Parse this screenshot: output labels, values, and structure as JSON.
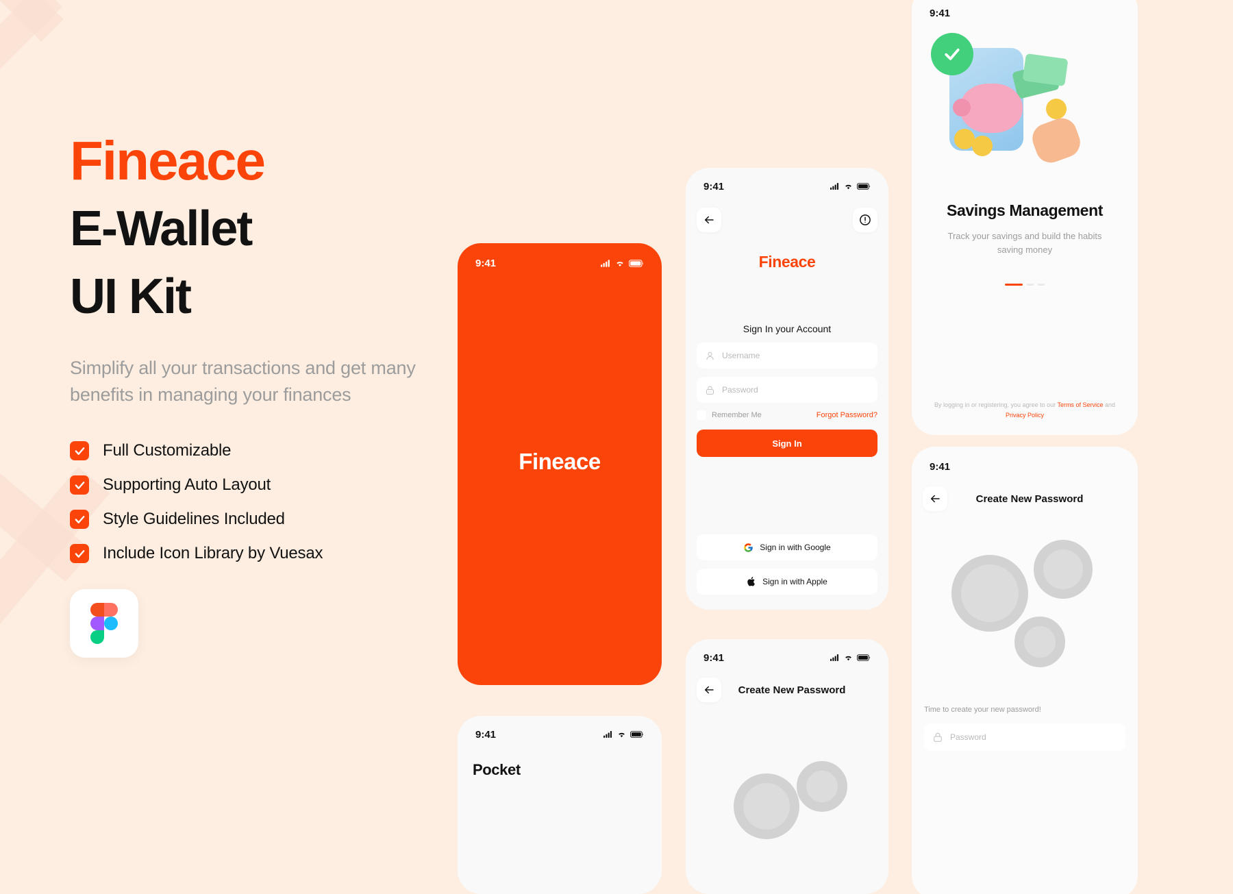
{
  "theme": {
    "background": "#FDEEE1",
    "accent": "#FB4409",
    "text_dark": "#121212",
    "text_muted": "#9C9C9C",
    "screen_bg": "#F9F9F9"
  },
  "hero": {
    "brand": "Fineace",
    "title_line1": "E-Wallet",
    "title_line2": "UI Kit",
    "subtitle": "Simplify all your transactions and get many benefits in managing your finances",
    "features": [
      {
        "label": "Full Customizable",
        "icon": "check-icon"
      },
      {
        "label": "Supporting Auto Layout",
        "icon": "check-icon"
      },
      {
        "label": "Style Guidelines Included",
        "icon": "check-icon"
      },
      {
        "label": "Include Icon Library by Vuesax",
        "icon": "check-icon"
      }
    ],
    "badge_icon": "figma-logo"
  },
  "splash_screen": {
    "status_time": "9:41",
    "status_icons": [
      "cellular-icon",
      "wifi-icon",
      "battery-icon"
    ],
    "logo": "Fineace"
  },
  "signin_screen": {
    "status_time": "9:41",
    "status_icons": [
      "cellular-icon",
      "wifi-icon",
      "battery-icon"
    ],
    "back_icon": "arrow-left-icon",
    "info_icon": "info-circle-icon",
    "logo": "Fineace",
    "heading": "Sign In your Account",
    "username_placeholder": "Username",
    "username_icon": "user-icon",
    "password_placeholder": "Password",
    "password_icon": "lock-icon",
    "remember_label": "Remember Me",
    "forgot_label": "Forgot Password?",
    "submit_label": "Sign In",
    "google_label": "Sign in with Google",
    "google_icon": "google-icon",
    "apple_label": "Sign in with Apple",
    "apple_icon": "apple-icon"
  },
  "onboarding_screen": {
    "status_time": "9:41",
    "title": "Savings Management",
    "description": "Track your savings and build the habits saving money",
    "pagination": {
      "total": 3,
      "active": 1
    },
    "legal_prefix": "By logging in or registering, you agree to our ",
    "legal_terms": "Terms of Service",
    "legal_mid": " and ",
    "legal_privacy": "Privacy Policy",
    "art_icon": "savings-3d-illustration"
  },
  "newpassword_right_screen": {
    "status_time": "9:41",
    "back_icon": "arrow-left-icon",
    "title": "Create New Password",
    "hint": "Time to create your new password!",
    "password_placeholder": "Password",
    "password_icon": "lock-icon",
    "art_icon": "gears-3d-illustration"
  },
  "newpassword_center_screen": {
    "status_time": "9:41",
    "status_icons": [
      "cellular-icon",
      "wifi-icon",
      "battery-icon"
    ],
    "back_icon": "arrow-left-icon",
    "title": "Create New Password"
  },
  "pocket_screen": {
    "status_time": "9:41",
    "status_icons": [
      "cellular-icon",
      "wifi-icon",
      "battery-icon"
    ],
    "title": "Pocket"
  }
}
